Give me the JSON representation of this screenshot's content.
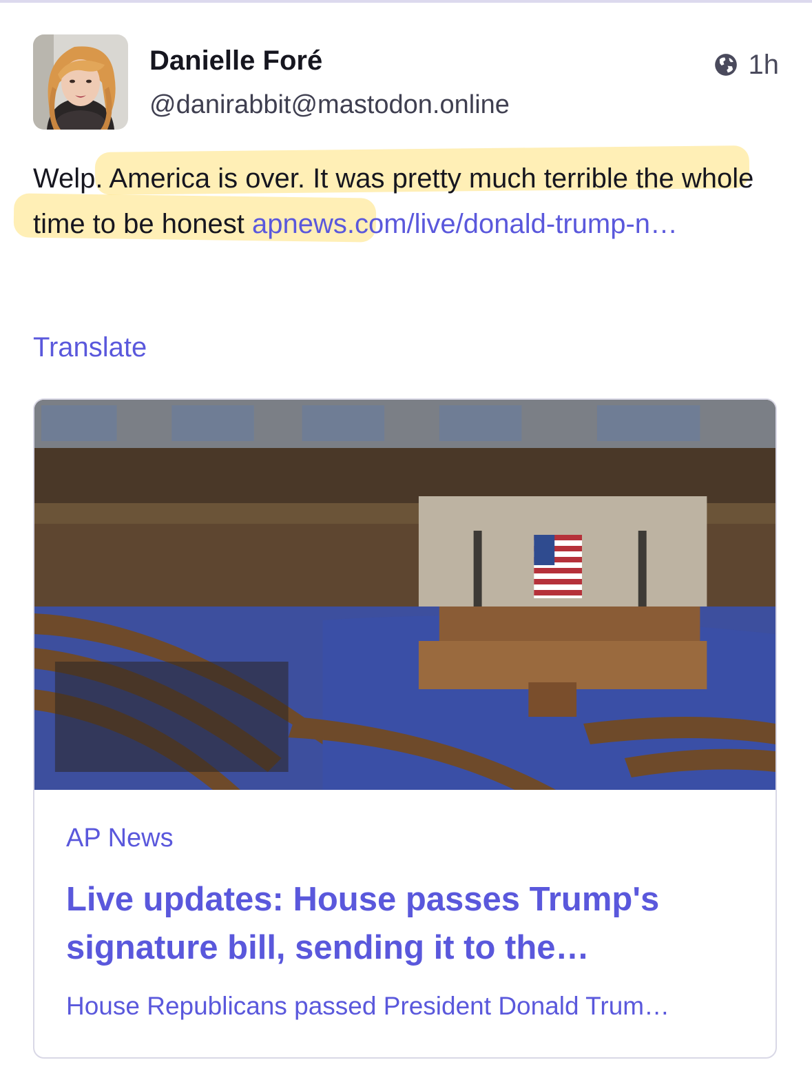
{
  "author": {
    "display_name": "Danielle Foré",
    "handle": "@danirabbit@mastodon.online",
    "avatar_icon": "user-avatar"
  },
  "meta": {
    "visibility_icon": "globe-icon",
    "timestamp": "1h"
  },
  "post": {
    "text": "Welp. America is over. It was pretty much terrible the whole time to be honest ",
    "link_text": "apnews.com/live/donald-trump-n…",
    "highlight_color": "#FFD640",
    "link_color": "#5A58DC"
  },
  "translate_label": "Translate",
  "card": {
    "provider": "AP News",
    "title": "Live updates: House passes Trump's signature bill, sending it to the…",
    "description": "House Republicans passed President Donald Trum…"
  }
}
